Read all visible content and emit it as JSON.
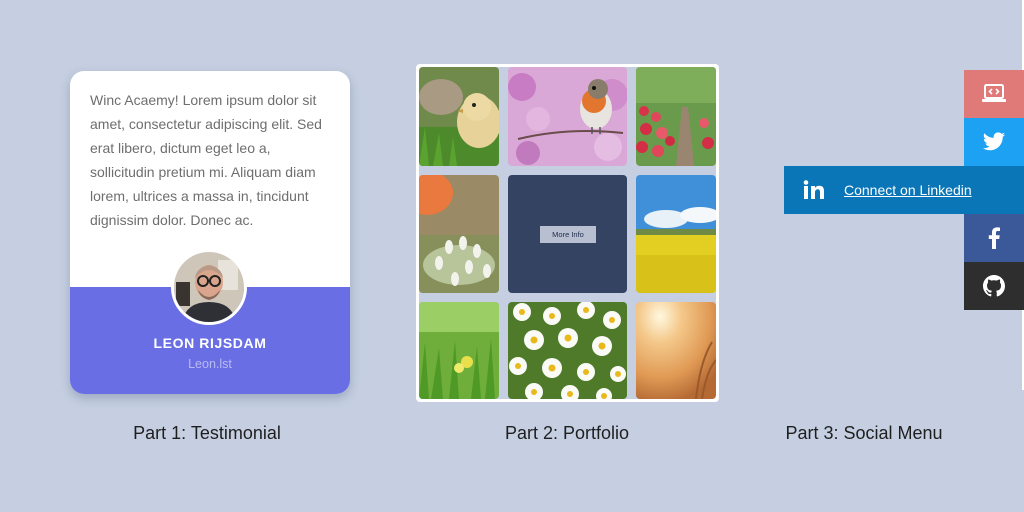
{
  "testimonial": {
    "quote": "Winc Acaemy! Lorem ipsum dolor sit amet, consectetur adipiscing elit. Sed erat libero, dictum eget leo a, sollicitudin pretium mi. Aliquam diam lorem, ultrices a massa in, tincidunt dignissim dolor. Donec ac.",
    "name": "LEON RIJSDAM",
    "handle": "Leon.lst",
    "band_color": "#6a6ee4"
  },
  "portfolio": {
    "more_info_label": "More Info",
    "tiles": [
      "duckling-photo",
      "robin-bird-photo",
      "tulip-garden-photo",
      "snowdrops-photo",
      "more-info-tile",
      "rapeseed-field-photo",
      "grass-flowers-photo",
      "daisies-photo",
      "sunlight-photo"
    ]
  },
  "social": {
    "items": [
      {
        "name": "portfolio",
        "icon": "laptop-code-icon",
        "color": "#e07a78"
      },
      {
        "name": "twitter",
        "icon": "twitter-icon",
        "color": "#1da1f2"
      },
      {
        "name": "linkedin",
        "icon": "linkedin-icon",
        "color": "#0a76b8",
        "label": "Connect on Linkedin"
      },
      {
        "name": "facebook",
        "icon": "facebook-icon",
        "color": "#3b5998"
      },
      {
        "name": "github",
        "icon": "github-icon",
        "color": "#2e2e2e"
      }
    ]
  },
  "captions": {
    "part1": "Part 1: Testimonial",
    "part2": "Part 2: Portfolio",
    "part3": "Part 3: Social Menu"
  }
}
